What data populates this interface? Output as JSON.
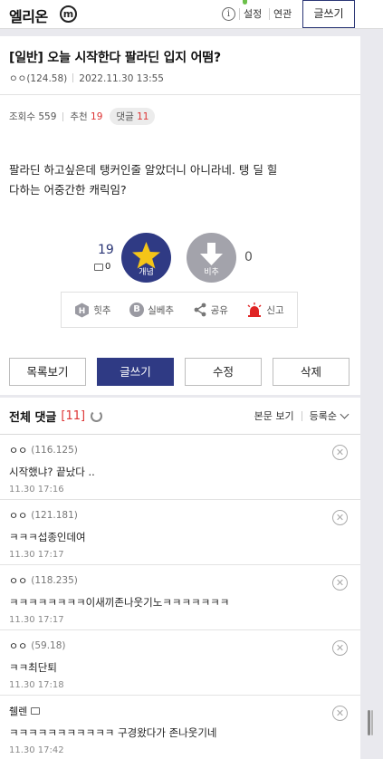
{
  "header": {
    "gallery_name": "엘리온",
    "badge": "m",
    "links": [
      "설정",
      "연관"
    ],
    "write_label": "글쓰기"
  },
  "post": {
    "title": "[일반] 오늘 시작한다 팔라딘 입지 어떰?",
    "author": "ㅇㅇ(124.58)",
    "date": "2022.11.30 13:55",
    "views_label": "조회수",
    "views": "559",
    "recommend_label": "추천",
    "recommend": "19",
    "comments_label": "댓글",
    "comments": "11",
    "body_line1": "팔라딘 하고싶은데 탱커인줄 알았더니 아니라네.  탱 딜 힐",
    "body_line2": "다하는 어중간한 캐릭임?"
  },
  "votes": {
    "up_count": "19",
    "up_sub": "0",
    "up_label": "개념",
    "down_label": "비추",
    "down_count": "0"
  },
  "actions": [
    "힛추",
    "실베추",
    "공유",
    "신고"
  ],
  "buttons": {
    "list": "목록보기",
    "write": "글쓰기",
    "edit": "수정",
    "delete": "삭제"
  },
  "comments_section": {
    "title": "전체 댓글",
    "count": "[11]",
    "view_original": "본문 보기",
    "sort": "등록순"
  },
  "comments": [
    {
      "nick": "ㅇㅇ",
      "ip": "(116.125)",
      "text": "시작했냐? 끝났다 ..",
      "time": "11.30 17:16"
    },
    {
      "nick": "ㅇㅇ",
      "ip": "(121.181)",
      "text": "ㅋㅋㅋ섭종인데여",
      "time": "11.30 17:17"
    },
    {
      "nick": "ㅇㅇ",
      "ip": "(118.235)",
      "text": "ㅋㅋㅋㅋㅋㅋㅋㅋ이새끼존나웃기노ㅋㅋㅋㅋㅋㅋㅋ",
      "time": "11.30 17:17"
    },
    {
      "nick": "ㅇㅇ",
      "ip": "(59.18)",
      "text": "ㅋㅋ최단퇴",
      "time": "11.30 17:18"
    },
    {
      "nick": "췔렌",
      "ip": "",
      "text": "ㅋㅋㅋㅋㅋㅋㅋㅋㅋㅋㅋ 구경왔다가 존나웃기네",
      "time": "11.30 17:42"
    }
  ],
  "colors": {
    "primary": "#2f3a84",
    "accent_red": "#dd3333",
    "downvote_gray": "#a3a3ab",
    "star_yellow": "#f5c518"
  }
}
